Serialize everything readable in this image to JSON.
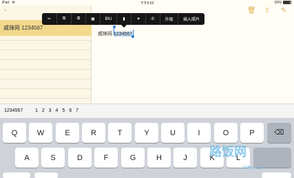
{
  "status_bar": {
    "carrier": "iPad",
    "wifi_icon": "wifi-icon",
    "time": "下午5:52",
    "battery_pct": "83%"
  },
  "sidebar": {
    "selected_note": "威锋网 1234567"
  },
  "note": {
    "text_plain": "威锋网 ",
    "text_selected": "1234567",
    "icons": [
      "trash-icon",
      "share-icon",
      "compose-icon"
    ]
  },
  "edit_menu": {
    "items": [
      {
        "name": "cut-icon",
        "glyph": "✂"
      },
      {
        "name": "copy-icon",
        "glyph": "⧉"
      },
      {
        "name": "copy-format-icon",
        "glyph": "⧉"
      },
      {
        "name": "paste-icon",
        "glyph": "▣"
      },
      {
        "name": "biu",
        "label": "BIU"
      },
      {
        "name": "document-icon",
        "glyph": "▮"
      },
      {
        "name": "heart-icon",
        "glyph": "♥"
      },
      {
        "name": "phone-icon",
        "glyph": "✆"
      },
      {
        "name": "upgrade",
        "label": "升级"
      },
      {
        "name": "insert-image",
        "label": "插入照片"
      }
    ]
  },
  "prediction": {
    "typed": "1234567",
    "candidates": "1 2 3 4 5 6 7"
  },
  "keyboard": {
    "row1": [
      "Q",
      "W",
      "E",
      "R",
      "T",
      "Y",
      "U",
      "I",
      "O",
      "P"
    ],
    "row2": [
      "A",
      "S",
      "D",
      "F",
      "G",
      "H",
      "J",
      "K",
      "L"
    ],
    "delete_icon": "backspace-icon"
  },
  "watermark": {
    "main": "路饭网",
    "sub": "45fan.com"
  }
}
